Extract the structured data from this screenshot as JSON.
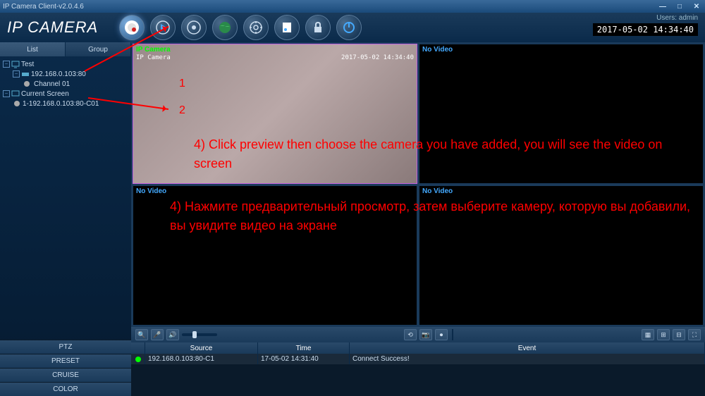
{
  "titlebar": {
    "title": "IP Camera Client-v2.0.4.6"
  },
  "header": {
    "logo": "IP CAMERA",
    "users_label": "Users: admin",
    "clock": "2017-05-02  14:34:40"
  },
  "sidebar": {
    "tabs": {
      "list": "List",
      "group": "Group"
    },
    "tree": {
      "test": "Test",
      "ip": "192.168.0.103:80",
      "channel": "Channel 01",
      "current_screen": "Current Screen",
      "stream": "1-192.168.0.103:80-C01"
    },
    "bottom": {
      "ptz": "PTZ",
      "preset": "PRESET",
      "cruise": "CRUISE",
      "color": "COLOR"
    }
  },
  "video": {
    "cells": [
      {
        "label": "IP Camera",
        "feed_name": "IP Camera",
        "feed_time": "2017-05-02 14:34:40"
      },
      {
        "label": "No Video"
      },
      {
        "label": "No Video"
      },
      {
        "label": "No Video"
      }
    ]
  },
  "events": {
    "headers": {
      "blank": "",
      "source": "Source",
      "time": "Time",
      "event": "Event"
    },
    "rows": [
      {
        "source": "192.168.0.103:80-C1",
        "time": "17-05-02 14:31:40",
        "event": "Connect Success!"
      }
    ]
  },
  "annotations": {
    "n1": "1",
    "n2": "2",
    "instruction_en": "4) Click preview then choose the camera you have added, you will see the video on screen",
    "instruction_ru": "4) Нажмите предварительный просмотр, затем выберите камеру, которую вы добавили, вы увидите видео на экране"
  }
}
